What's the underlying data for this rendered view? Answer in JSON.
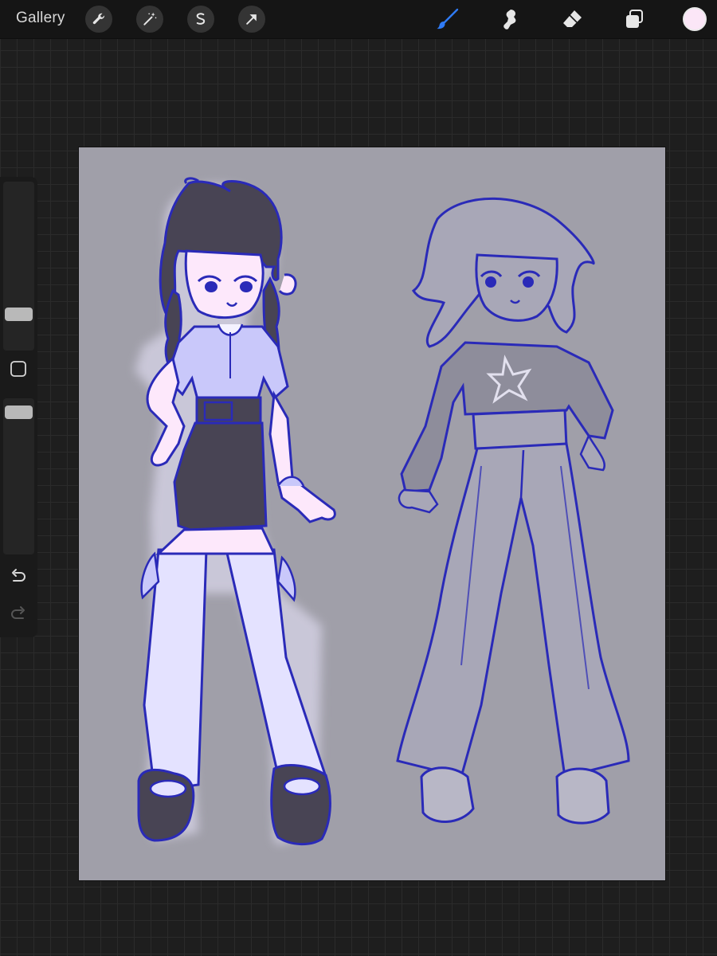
{
  "toolbar": {
    "gallery_label": "Gallery",
    "left_tools": [
      "wrench-icon",
      "magic-wand-icon",
      "selection-icon",
      "transform-arrow-icon"
    ],
    "right_tools": [
      "brush-icon",
      "smudge-icon",
      "eraser-icon",
      "layers-icon"
    ],
    "active_tool": "brush",
    "active_tool_color": "#2f7bf6",
    "current_color": "#fbe6f7"
  },
  "sidebar": {
    "controls": [
      "brush-size-slider",
      "modify-button",
      "opacity-slider",
      "undo-icon",
      "redo-icon"
    ]
  },
  "canvas": {
    "background": "#a09fa9",
    "line_color": "#2a2ab8"
  }
}
